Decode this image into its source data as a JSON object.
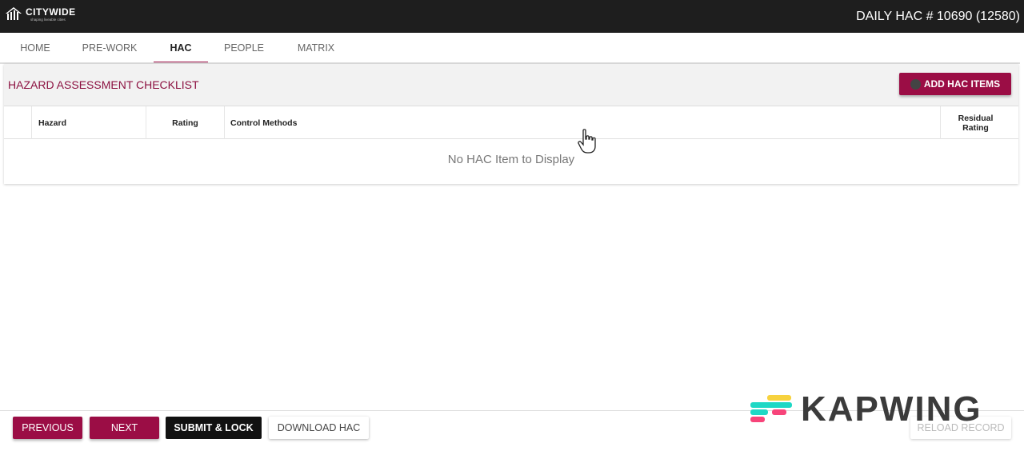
{
  "header": {
    "brand_name": "CITYWIDE",
    "brand_tagline": "shaping liveable cities",
    "title": "DAILY HAC # 10690 (12580)"
  },
  "tabs": [
    {
      "label": "HOME",
      "active": false
    },
    {
      "label": "PRE-WORK",
      "active": false
    },
    {
      "label": "HAC",
      "active": true
    },
    {
      "label": "PEOPLE",
      "active": false
    },
    {
      "label": "MATRIX",
      "active": false
    }
  ],
  "panel": {
    "title": "HAZARD ASSESSMENT CHECKLIST",
    "add_button_label": "ADD HAC ITEMS",
    "columns": [
      "Hazard",
      "Rating",
      "Control Methods",
      "Residual Rating"
    ],
    "empty_message": "No HAC Item to Display"
  },
  "footer": {
    "previous_label": "PREVIOUS",
    "next_label": "NEXT",
    "submit_label": "SUBMIT & LOCK",
    "download_label": "DOWNLOAD HAC",
    "reload_label": "RELOAD RECORD"
  },
  "watermark": {
    "text": "KAPWING"
  },
  "colors": {
    "accent": "#9b0d45",
    "header_bg": "#1e1e1e",
    "title_text": "#8c1141"
  },
  "icons": {
    "logo": "citywide-logo-icon",
    "add": "add-circle-icon",
    "cursor": "hand-pointer-icon"
  }
}
